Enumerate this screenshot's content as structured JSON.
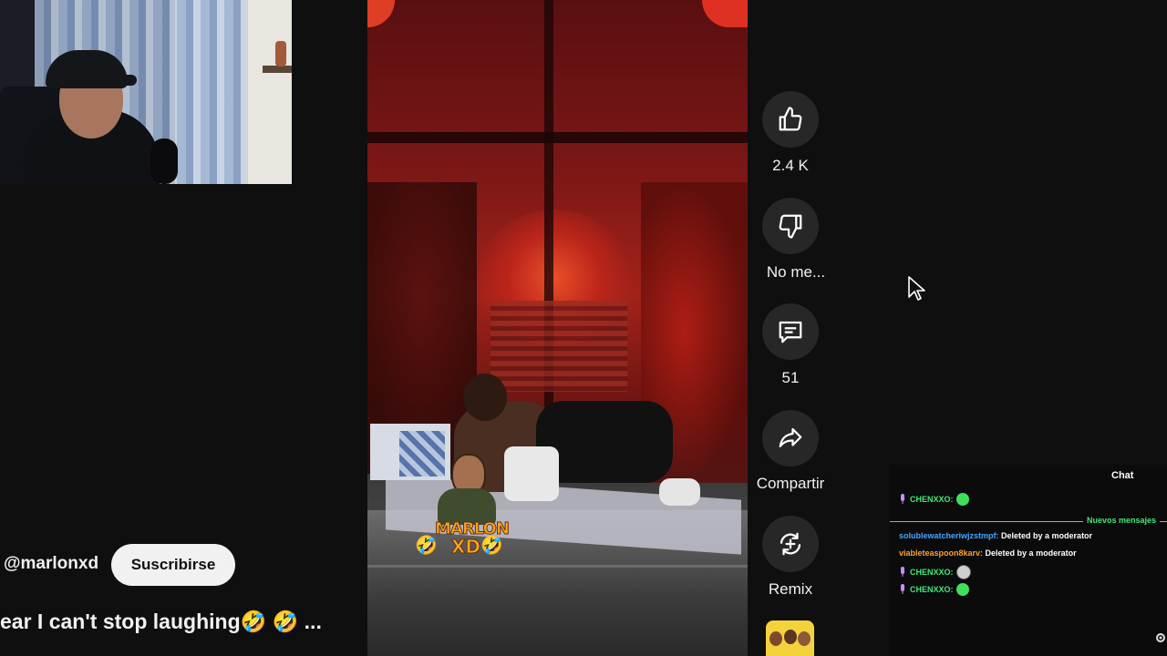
{
  "channel": {
    "handle": "@marlonxd",
    "subscribe_label": "Suscribirse"
  },
  "video": {
    "title": "ear I can't stop laughing🤣 🤣 ..."
  },
  "watermark": {
    "line1": "MARLON",
    "line2": "XD",
    "emoji": "🤣"
  },
  "actions": {
    "like": {
      "icon": "thumbs-up-icon",
      "label": "2.4 K"
    },
    "dislike": {
      "icon": "thumbs-down-icon",
      "label": "No me..."
    },
    "comments": {
      "icon": "comment-icon",
      "label": "51"
    },
    "share": {
      "icon": "share-icon",
      "label": "Compartir"
    },
    "remix": {
      "icon": "remix-icon",
      "label": "Remix"
    }
  },
  "chat": {
    "title": "Chat",
    "new_messages_label": "Nuevos mensajes",
    "messages": [
      {
        "user": "CHENXXO",
        "sep": ":",
        "text": "",
        "emote": "green"
      },
      {
        "user": "solublewatcheriwjzstmpf",
        "sep": ":",
        "text": " Deleted by a moderator"
      },
      {
        "user": "viableteaspoon8karv",
        "sep": ":",
        "text": " Deleted by a moderator"
      },
      {
        "user": "CHENXXO",
        "sep": ":",
        "text": "",
        "emote": "gray"
      },
      {
        "user": "CHENXXO",
        "sep": ":",
        "text": "",
        "emote": "green"
      }
    ]
  },
  "colors": {
    "accent_green": "#3fe87c",
    "action_bg": "#272727",
    "subscribe_bg": "#f1f1f1"
  }
}
